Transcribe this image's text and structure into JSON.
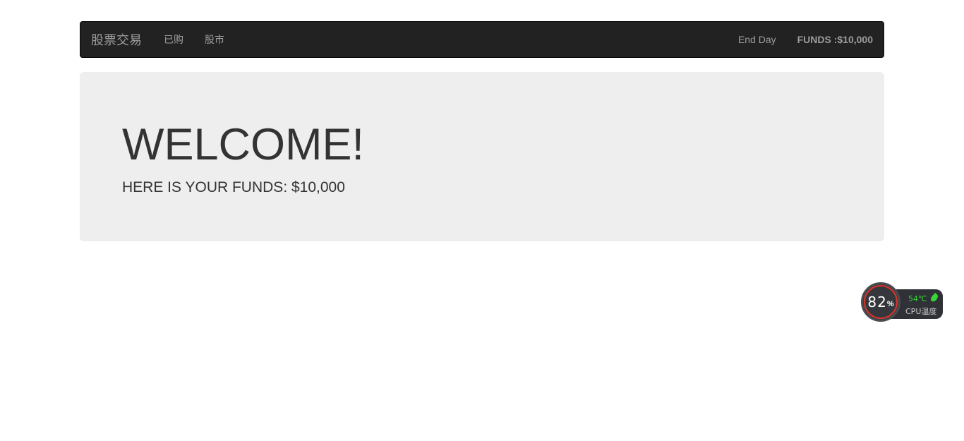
{
  "navbar": {
    "brand": "股票交易",
    "links": [
      "已购",
      "股市"
    ],
    "end_day": "End Day",
    "funds": "FUNDS :$10,000"
  },
  "jumbotron": {
    "title": "WELCOME!",
    "subtitle": "HERE IS YOUR FUNDS: $10,000"
  },
  "cpu_widget": {
    "percent": "82",
    "percent_sign": "%",
    "temperature": "54℃",
    "label": "CPU温度",
    "icon": "leaf-icon",
    "ring_color": "#d9342b",
    "temp_color": "#35d635"
  },
  "colors": {
    "navbar_bg": "#222222",
    "jumbotron_bg": "#eeeeee",
    "text": "#333333"
  }
}
